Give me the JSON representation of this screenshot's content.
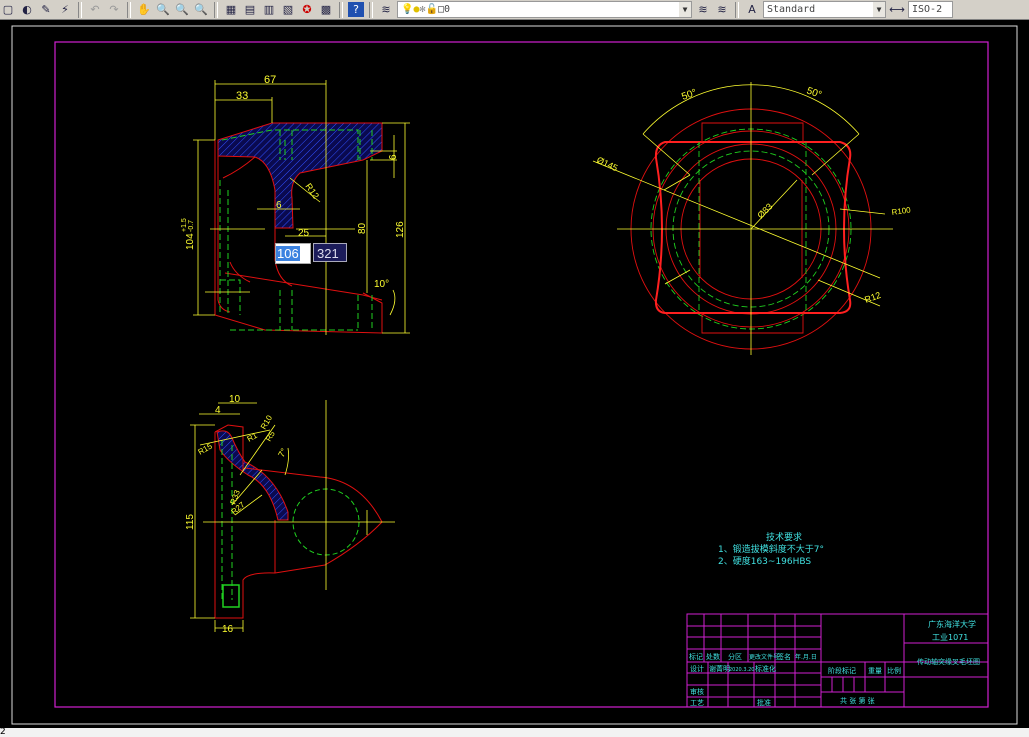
{
  "toolbar": {
    "icons": [
      "new-icon",
      "open-icon",
      "pencil-icon",
      "match-properties-icon",
      "undo-icon",
      "redo-icon",
      "pan-icon",
      "zoom-realtime-icon",
      "zoom-window-icon",
      "zoom-previous-icon",
      "properties-icon",
      "design-center-icon",
      "tool-palettes-icon",
      "sheet-set-icon",
      "markup-icon",
      "calculator-icon",
      "help-icon",
      "layer-manager-icon"
    ],
    "layer_value": "0",
    "text_style": "Standard",
    "dim_style": "ISO-2"
  },
  "colors": {
    "background": "#000000",
    "outline": "#e01010",
    "hidden": "#20d020",
    "dimension": "#ffff30",
    "frame": "#d020d0",
    "note_text": "#40e0e0"
  },
  "front_view": {
    "dims": {
      "d67": "67",
      "d33": "33",
      "d104": "104",
      "d104_tol_upper": "+1.5",
      "d104_tol_lower": "-0.7",
      "r12": "R12",
      "d6a": "6",
      "d25": "25",
      "d80": "80",
      "d126": "126",
      "d6b": "6",
      "angle10": "10°"
    },
    "dynamic_input": {
      "value1": "106",
      "value2": "321"
    }
  },
  "top_view": {
    "dims": {
      "ang1": "50°",
      "ang2": "50°",
      "dia145": "Ø145",
      "dia83": "Ø83",
      "r100": "R100",
      "r12": "R12"
    }
  },
  "side_view": {
    "dims": {
      "d10": "10",
      "d4": "4",
      "d115": "115",
      "d16": "16",
      "r15": "R15",
      "r1": "R1",
      "r10": "R10",
      "r5": "R5",
      "angle7": "7°",
      "r33": "R33",
      "r27": "R27"
    }
  },
  "notes": {
    "title": "技术要求",
    "items": [
      "1、锻造拔模斜度不大于7°",
      "2、硬度163~196HBS"
    ]
  },
  "title_block": {
    "school": "广东海洋大学",
    "class": "工业1071",
    "drawing_name": "传动轴突缘叉毛坯图",
    "row_headers": [
      "标记",
      "处数",
      "分区",
      "更改文件号",
      "签名",
      "年.月.日"
    ],
    "design_row": [
      "设计",
      "谢菁明",
      "2020.3.20",
      "标准化"
    ],
    "stage_headers": [
      "阶段标记",
      "重量",
      "比例"
    ],
    "review": "审核",
    "process": "工艺",
    "approve": "批准",
    "sheets": "共 张 第 张"
  },
  "command_line": {
    "text": "2"
  }
}
